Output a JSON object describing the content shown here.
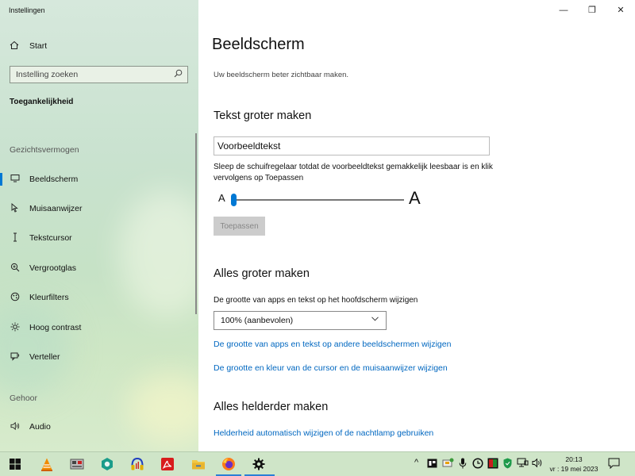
{
  "app": {
    "title": "Instellingen"
  },
  "window_controls": {
    "minimize": "—",
    "maximize": "❐",
    "close": "✕"
  },
  "sidebar": {
    "home": {
      "label": "Start",
      "icon": "home-icon"
    },
    "search": {
      "placeholder": "Instelling zoeken",
      "icon": "search-icon"
    },
    "section_title": "Toegankelijkheid",
    "groups": [
      {
        "label": "Gezichtsvermogen"
      },
      {
        "label": "Gehoor"
      }
    ],
    "items": [
      {
        "label": "Beeldscherm",
        "icon": "monitor-icon",
        "selected": true
      },
      {
        "label": "Muisaanwijzer",
        "icon": "mouse-pointer-icon"
      },
      {
        "label": "Tekstcursor",
        "icon": "text-cursor-icon"
      },
      {
        "label": "Vergrootglas",
        "icon": "magnifier-icon"
      },
      {
        "label": "Kleurfilters",
        "icon": "color-filter-icon"
      },
      {
        "label": "Hoog contrast",
        "icon": "high-contrast-icon"
      },
      {
        "label": "Verteller",
        "icon": "narrator-icon"
      },
      {
        "label": "Audio",
        "icon": "speaker-icon"
      }
    ]
  },
  "main": {
    "title": "Beeldscherm",
    "subtitle": "Uw beeldscherm beter zichtbaar maken.",
    "text_section": {
      "heading": "Tekst groter maken",
      "preview_text": "Voorbeeldtekst",
      "hint": "Sleep de schuifregelaar totdat de voorbeeldtekst gemakkelijk leesbaar is en klik vervolgens op Toepassen",
      "slider_min_label": "A",
      "slider_max_label": "A",
      "slider_value_percent": 0,
      "apply_label": "Toepassen"
    },
    "scale_section": {
      "heading": "Alles groter maken",
      "label": "De grootte van apps en tekst op het hoofdscherm wijzigen",
      "select_value": "100% (aanbevolen)",
      "link_other_displays": "De grootte van apps en tekst op andere beeldschermen wijzigen",
      "link_cursor": "De grootte en kleur van de cursor en de muisaanwijzer wijzigen"
    },
    "bright_section": {
      "heading": "Alles helderder maken",
      "link_brightness": "Helderheid automatisch wijzigen of de nachtlamp gebruiken"
    }
  },
  "taskbar": {
    "apps": [
      {
        "icon": "windows-start-icon"
      },
      {
        "icon": "vlc-icon"
      },
      {
        "icon": "file-manager-icon"
      },
      {
        "icon": "hex-app-icon"
      },
      {
        "icon": "audio-app-icon"
      },
      {
        "icon": "pdf-reader-icon"
      },
      {
        "icon": "folder-icon"
      },
      {
        "icon": "firefox-icon",
        "active": true
      },
      {
        "icon": "settings-gear-icon",
        "active": true
      }
    ],
    "tray": {
      "chevron": "^",
      "time": "20:13",
      "date": "vr : 19 mei 2023"
    },
    "accent": "#0078d4"
  }
}
